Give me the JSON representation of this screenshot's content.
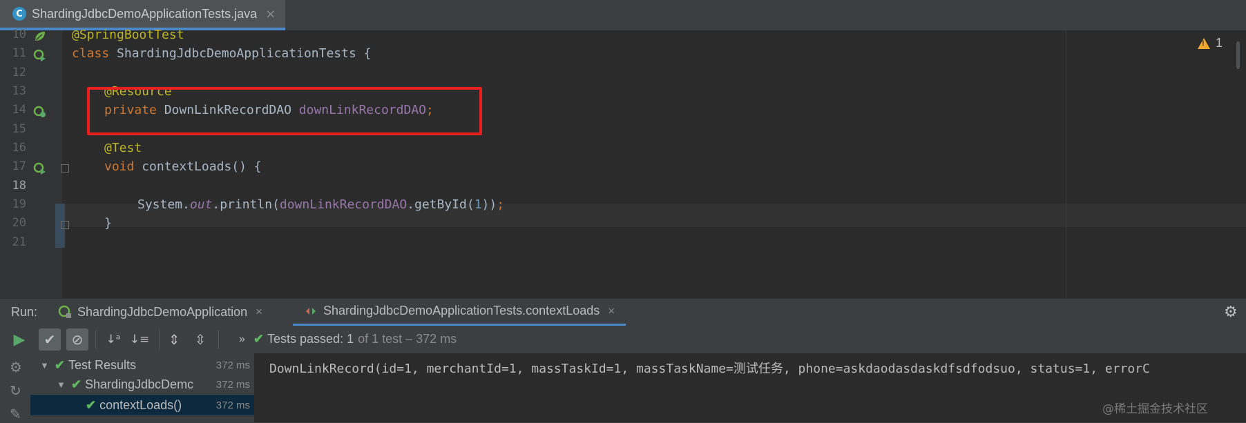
{
  "editor_tab": {
    "filename": "ShardingJdbcDemoApplicationTests.java"
  },
  "warnings": {
    "count": "1"
  },
  "lines": {
    "l10": "10",
    "l11": "11",
    "l12": "12",
    "l13": "13",
    "l14": "14",
    "l15": "15",
    "l16": "16",
    "l17": "17",
    "l18": "18",
    "l19": "19",
    "l20": "20",
    "l21": "21"
  },
  "code": {
    "annotation_springboot": "@SpringBootTest",
    "class_kw": "class",
    "class_name": " ShardingJdbcDemoApplicationTests {",
    "annotation_resource": "@Resource",
    "private_kw": "private",
    "dao_type": " DownLinkRecordDAO ",
    "dao_field": "downLinkRecordDAO",
    "semicolon": ";",
    "annotation_test": "@Test",
    "void_kw": "void",
    "method": " contextLoads() {",
    "sys": "System.",
    "out": "out",
    "println": ".println(",
    "call_field": "downLinkRecordDAO",
    "getby": ".getById(",
    "arg": "1",
    "close_call": "))",
    "close_brace": "}"
  },
  "run_panel": {
    "label": "Run:",
    "tab1": "ShardingJdbcDemoApplication",
    "tab2": "ShardingJdbcDemoApplicationTests.contextLoads",
    "status_passed": "Tests passed:",
    "status_count": "1",
    "status_rest": "of 1 test – 372 ms"
  },
  "tree": {
    "row1_label": "Test Results",
    "row1_ms": "372 ms",
    "row2_label": "ShardingJdbcDemc",
    "row2_ms": "372 ms",
    "row3_label": "contextLoads()",
    "row3_ms": "372 ms"
  },
  "console": {
    "output": "DownLinkRecord(id=1, merchantId=1, massTaskId=1, massTaskName=测试任务, phone=askdaodasdaskdfsdfodsuo, status=1, errorC"
  },
  "watermark": "@稀土掘金技术社区",
  "colors": {
    "accent": "#4a88c7",
    "highlight_box": "#e82020",
    "pass_green": "#5fb85f"
  }
}
